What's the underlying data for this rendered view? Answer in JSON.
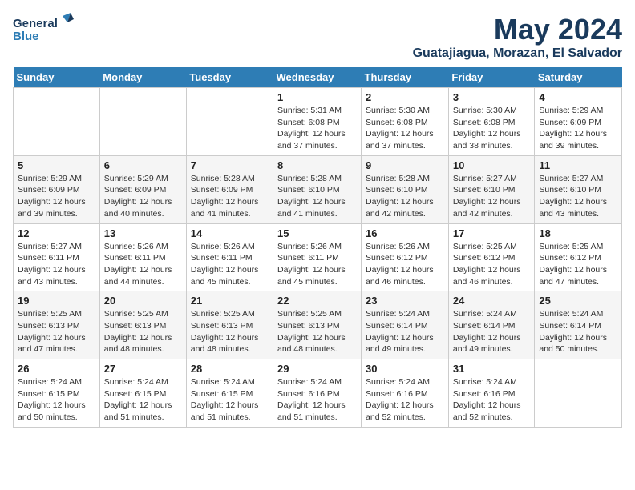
{
  "header": {
    "logo_top": "General",
    "logo_bottom": "Blue",
    "month": "May 2024",
    "location": "Guatajiagua, Morazan, El Salvador"
  },
  "weekdays": [
    "Sunday",
    "Monday",
    "Tuesday",
    "Wednesday",
    "Thursday",
    "Friday",
    "Saturday"
  ],
  "weeks": [
    [
      {
        "day": "",
        "info": ""
      },
      {
        "day": "",
        "info": ""
      },
      {
        "day": "",
        "info": ""
      },
      {
        "day": "1",
        "info": "Sunrise: 5:31 AM\nSunset: 6:08 PM\nDaylight: 12 hours\nand 37 minutes."
      },
      {
        "day": "2",
        "info": "Sunrise: 5:30 AM\nSunset: 6:08 PM\nDaylight: 12 hours\nand 37 minutes."
      },
      {
        "day": "3",
        "info": "Sunrise: 5:30 AM\nSunset: 6:08 PM\nDaylight: 12 hours\nand 38 minutes."
      },
      {
        "day": "4",
        "info": "Sunrise: 5:29 AM\nSunset: 6:09 PM\nDaylight: 12 hours\nand 39 minutes."
      }
    ],
    [
      {
        "day": "5",
        "info": "Sunrise: 5:29 AM\nSunset: 6:09 PM\nDaylight: 12 hours\nand 39 minutes."
      },
      {
        "day": "6",
        "info": "Sunrise: 5:29 AM\nSunset: 6:09 PM\nDaylight: 12 hours\nand 40 minutes."
      },
      {
        "day": "7",
        "info": "Sunrise: 5:28 AM\nSunset: 6:09 PM\nDaylight: 12 hours\nand 41 minutes."
      },
      {
        "day": "8",
        "info": "Sunrise: 5:28 AM\nSunset: 6:10 PM\nDaylight: 12 hours\nand 41 minutes."
      },
      {
        "day": "9",
        "info": "Sunrise: 5:28 AM\nSunset: 6:10 PM\nDaylight: 12 hours\nand 42 minutes."
      },
      {
        "day": "10",
        "info": "Sunrise: 5:27 AM\nSunset: 6:10 PM\nDaylight: 12 hours\nand 42 minutes."
      },
      {
        "day": "11",
        "info": "Sunrise: 5:27 AM\nSunset: 6:10 PM\nDaylight: 12 hours\nand 43 minutes."
      }
    ],
    [
      {
        "day": "12",
        "info": "Sunrise: 5:27 AM\nSunset: 6:11 PM\nDaylight: 12 hours\nand 43 minutes."
      },
      {
        "day": "13",
        "info": "Sunrise: 5:26 AM\nSunset: 6:11 PM\nDaylight: 12 hours\nand 44 minutes."
      },
      {
        "day": "14",
        "info": "Sunrise: 5:26 AM\nSunset: 6:11 PM\nDaylight: 12 hours\nand 45 minutes."
      },
      {
        "day": "15",
        "info": "Sunrise: 5:26 AM\nSunset: 6:11 PM\nDaylight: 12 hours\nand 45 minutes."
      },
      {
        "day": "16",
        "info": "Sunrise: 5:26 AM\nSunset: 6:12 PM\nDaylight: 12 hours\nand 46 minutes."
      },
      {
        "day": "17",
        "info": "Sunrise: 5:25 AM\nSunset: 6:12 PM\nDaylight: 12 hours\nand 46 minutes."
      },
      {
        "day": "18",
        "info": "Sunrise: 5:25 AM\nSunset: 6:12 PM\nDaylight: 12 hours\nand 47 minutes."
      }
    ],
    [
      {
        "day": "19",
        "info": "Sunrise: 5:25 AM\nSunset: 6:13 PM\nDaylight: 12 hours\nand 47 minutes."
      },
      {
        "day": "20",
        "info": "Sunrise: 5:25 AM\nSunset: 6:13 PM\nDaylight: 12 hours\nand 48 minutes."
      },
      {
        "day": "21",
        "info": "Sunrise: 5:25 AM\nSunset: 6:13 PM\nDaylight: 12 hours\nand 48 minutes."
      },
      {
        "day": "22",
        "info": "Sunrise: 5:25 AM\nSunset: 6:13 PM\nDaylight: 12 hours\nand 48 minutes."
      },
      {
        "day": "23",
        "info": "Sunrise: 5:24 AM\nSunset: 6:14 PM\nDaylight: 12 hours\nand 49 minutes."
      },
      {
        "day": "24",
        "info": "Sunrise: 5:24 AM\nSunset: 6:14 PM\nDaylight: 12 hours\nand 49 minutes."
      },
      {
        "day": "25",
        "info": "Sunrise: 5:24 AM\nSunset: 6:14 PM\nDaylight: 12 hours\nand 50 minutes."
      }
    ],
    [
      {
        "day": "26",
        "info": "Sunrise: 5:24 AM\nSunset: 6:15 PM\nDaylight: 12 hours\nand 50 minutes."
      },
      {
        "day": "27",
        "info": "Sunrise: 5:24 AM\nSunset: 6:15 PM\nDaylight: 12 hours\nand 51 minutes."
      },
      {
        "day": "28",
        "info": "Sunrise: 5:24 AM\nSunset: 6:15 PM\nDaylight: 12 hours\nand 51 minutes."
      },
      {
        "day": "29",
        "info": "Sunrise: 5:24 AM\nSunset: 6:16 PM\nDaylight: 12 hours\nand 51 minutes."
      },
      {
        "day": "30",
        "info": "Sunrise: 5:24 AM\nSunset: 6:16 PM\nDaylight: 12 hours\nand 52 minutes."
      },
      {
        "day": "31",
        "info": "Sunrise: 5:24 AM\nSunset: 6:16 PM\nDaylight: 12 hours\nand 52 minutes."
      },
      {
        "day": "",
        "info": ""
      }
    ]
  ]
}
